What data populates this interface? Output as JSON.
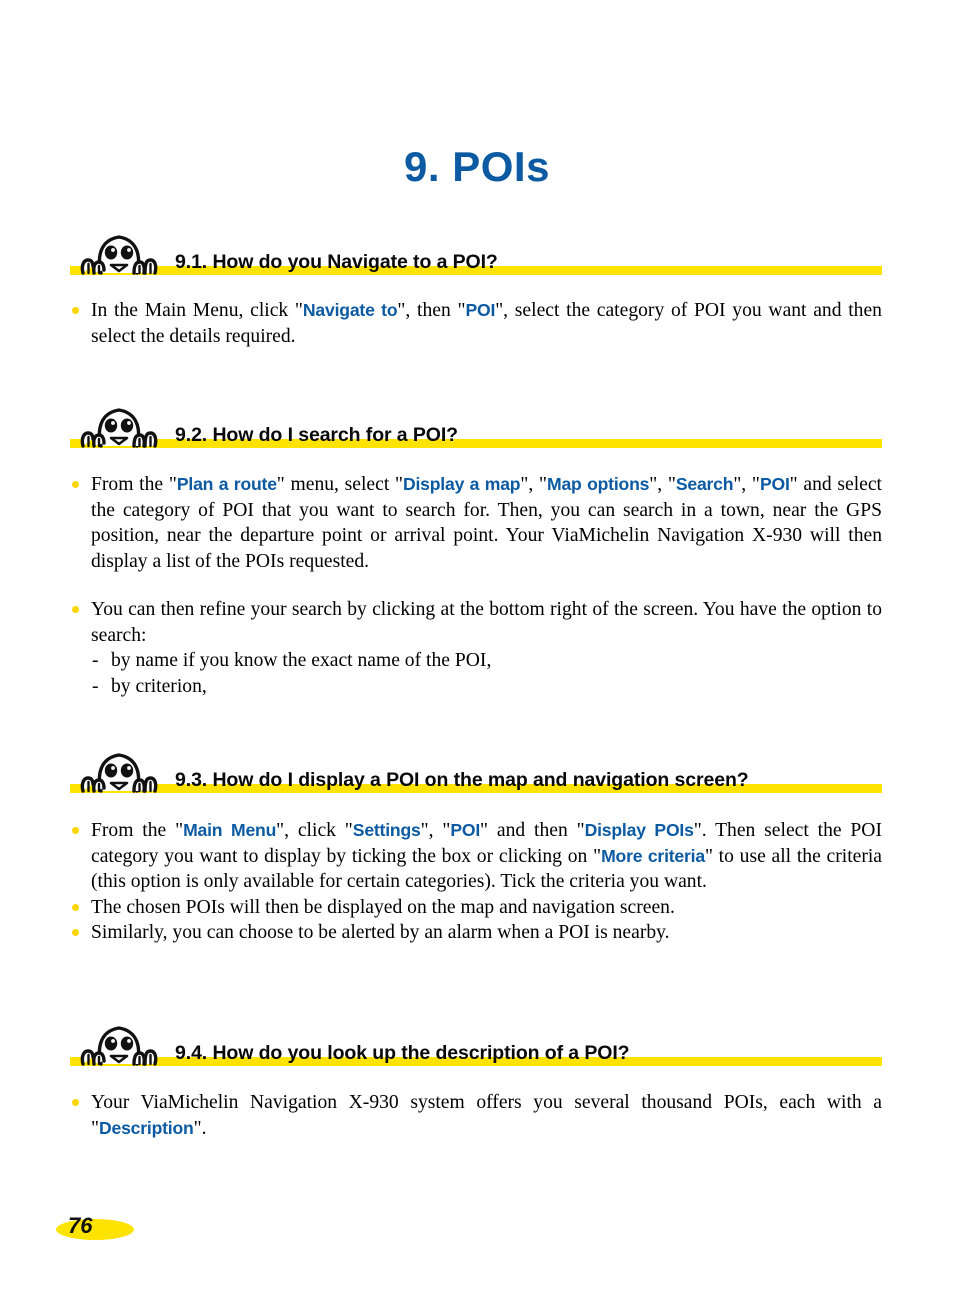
{
  "document": {
    "chapter_title": "9. POIs",
    "page_number": "76",
    "accent_blue": "#0B5AA2",
    "accent_yellow": "#FFE300",
    "bullet_yellow": "#FFD500"
  },
  "icons": {
    "mascot": "michelin-bibendum-icon"
  },
  "sections": [
    {
      "id": "9-1",
      "heading": "9.1. How do you Navigate to a POI?",
      "bullets": [
        {
          "parts": [
            {
              "t": "In the Main Menu, click \"",
              "ui": false
            },
            {
              "t": "Navigate to",
              "ui": true
            },
            {
              "t": "\", then \"",
              "ui": false
            },
            {
              "t": "POI",
              "ui": true
            },
            {
              "t": "\", select the category of POI you want and then select the details required.",
              "ui": false
            }
          ]
        }
      ]
    },
    {
      "id": "9-2",
      "heading": "9.2. How do I search for a POI?",
      "bullets": [
        {
          "parts": [
            {
              "t": "From the \"",
              "ui": false
            },
            {
              "t": "Plan a route",
              "ui": true
            },
            {
              "t": "\" menu, select \"",
              "ui": false
            },
            {
              "t": "Display a map",
              "ui": true
            },
            {
              "t": "\", \"",
              "ui": false
            },
            {
              "t": "Map options",
              "ui": true
            },
            {
              "t": "\", \"",
              "ui": false
            },
            {
              "t": "Search",
              "ui": true
            },
            {
              "t": "\", \"",
              "ui": false
            },
            {
              "t": "POI",
              "ui": true
            },
            {
              "t": "\" and select the category of POI that you want to search for. Then, you can search in a town, near the GPS position, near the departure point or arrival point. Your ViaMichelin Navigation X-930 will then display a list of the POIs requested.",
              "ui": false
            }
          ]
        },
        {
          "parts": [
            {
              "t": "You can then refine your search by clicking at the bottom right of the screen. You have the option to search:",
              "ui": false
            }
          ],
          "sub_items": [
            "by name if you know the exact name of the POI,",
            "by criterion,"
          ]
        }
      ]
    },
    {
      "id": "9-3",
      "heading": "9.3. How do I display a POI on the map and navigation screen?",
      "bullets": [
        {
          "parts": [
            {
              "t": "From the \"",
              "ui": false
            },
            {
              "t": "Main Menu",
              "ui": true
            },
            {
              "t": "\", click \"",
              "ui": false
            },
            {
              "t": "Settings",
              "ui": true
            },
            {
              "t": "\", \"",
              "ui": false
            },
            {
              "t": "POI",
              "ui": true
            },
            {
              "t": "\" and then \"",
              "ui": false
            },
            {
              "t": "Display POIs",
              "ui": true
            },
            {
              "t": "\". Then select the POI category you want to display by ticking the box or clicking on \"",
              "ui": false
            },
            {
              "t": "More criteria",
              "ui": true
            },
            {
              "t": "\" to use all the criteria (this option is only available for certain categories). Tick the criteria you want.",
              "ui": false
            }
          ]
        },
        {
          "parts": [
            {
              "t": "The chosen POIs will then be displayed on the map and navigation screen.",
              "ui": false
            }
          ]
        },
        {
          "parts": [
            {
              "t": "Similarly, you can choose to be alerted by an alarm when a POI is nearby.",
              "ui": false
            }
          ]
        }
      ]
    },
    {
      "id": "9-4",
      "heading": "9.4. How do you look up the description of a POI?",
      "bullets": [
        {
          "parts": [
            {
              "t": "Your ViaMichelin Navigation X-930 system offers you several thousand POIs, each with a \"",
              "ui": false
            },
            {
              "t": "Description",
              "ui": true
            },
            {
              "t": "\".",
              "ui": false
            }
          ]
        }
      ]
    }
  ]
}
